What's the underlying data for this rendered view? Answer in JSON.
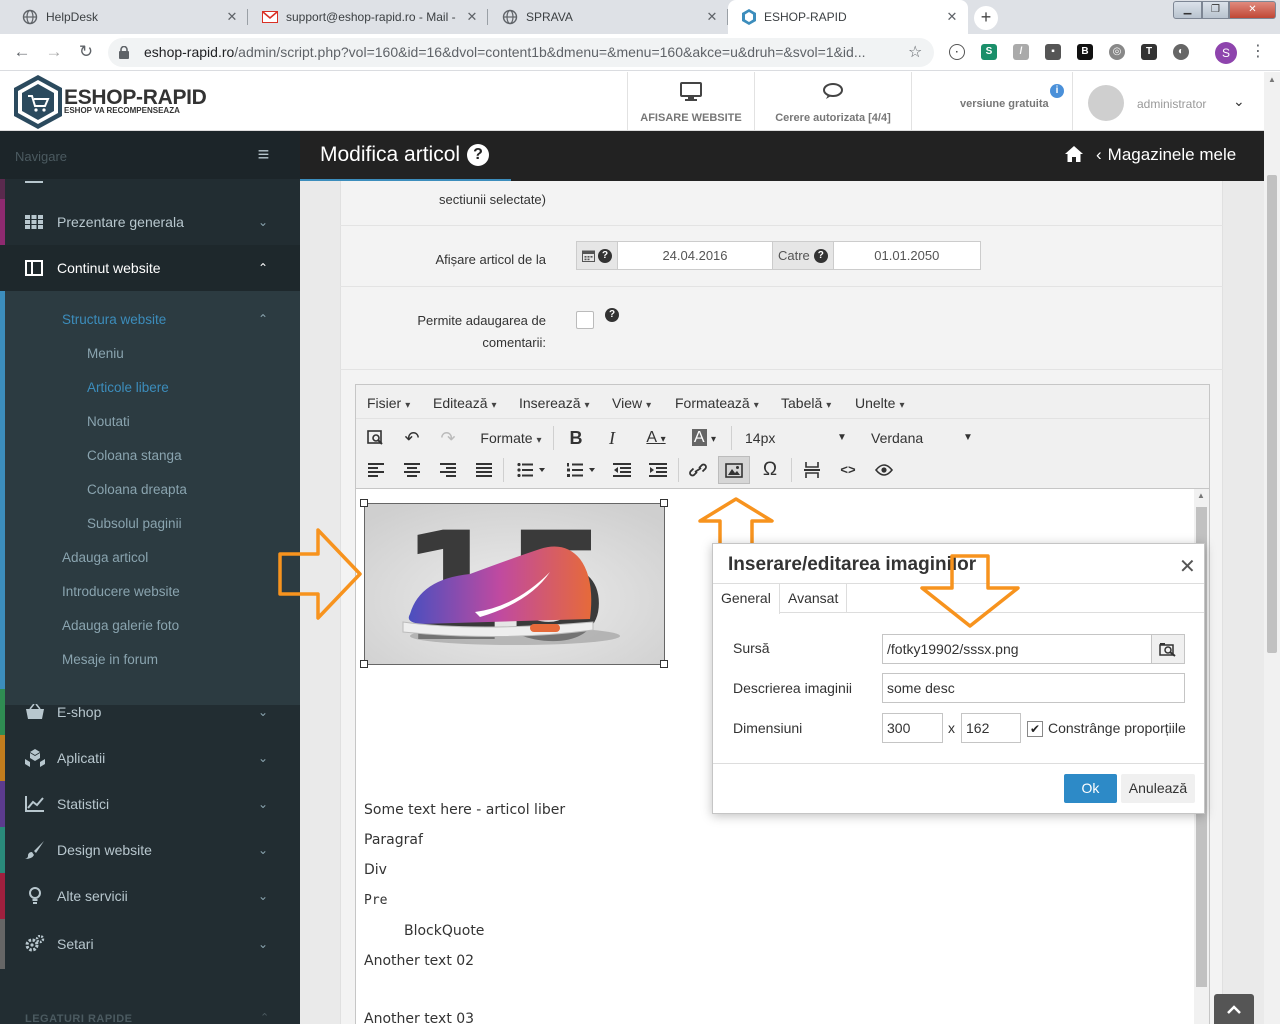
{
  "browser": {
    "tabs": [
      {
        "title": "HelpDesk",
        "icon": "globe-icon"
      },
      {
        "title": "support@eshop-rapid.ro - Mail -",
        "icon": "mail-icon"
      },
      {
        "title": "SPRAVA",
        "icon": "globe-icon"
      },
      {
        "title": "ESHOP-RAPID",
        "icon": "site-icon"
      }
    ],
    "close_glyph": "✕",
    "new_tab_glyph": "+",
    "url_host": "eshop-rapid.ro",
    "url_path": "/admin/script.php?vol=160&id=16&dvol=content1b&dmenu=&menu=160&akce=u&druh=&svol=1&id...",
    "profile_initial": "S"
  },
  "app": {
    "logo_name": "ESHOP-RAPID",
    "logo_tagline": "ESHOP VA RECOMPENSEAZA",
    "header_buttons": {
      "view_site": "AFISARE WEBSITE",
      "requests": "Cerere autorizata [4/4]"
    },
    "version_label": "versiune gratuita",
    "user_name": "administrator"
  },
  "sidebar": {
    "nav_label": "Navigare",
    "items": [
      {
        "label": "Prezentare generala",
        "icon": "grid-icon",
        "strip": "#8e2a70"
      },
      {
        "label": "Continut website",
        "icon": "columns-icon",
        "strip": "#3c8dbc"
      },
      {
        "label": "E-shop",
        "icon": "basket-icon",
        "strip": "#2f8c52"
      },
      {
        "label": "Aplicatii",
        "icon": "cubes-icon",
        "strip": "#c27d1e"
      },
      {
        "label": "Statistici",
        "icon": "chart-icon",
        "strip": "#5c3b8e"
      },
      {
        "label": "Design website",
        "icon": "brush-icon",
        "strip": "#2a8a7a"
      },
      {
        "label": "Alte servicii",
        "icon": "bulb-icon",
        "strip": "#a0203e"
      },
      {
        "label": "Setari",
        "icon": "cogs-icon",
        "strip": "#666666"
      }
    ],
    "sub_structura": "Structura website",
    "sub_items": [
      "Meniu",
      "Articole libere",
      "Noutati",
      "Coloana stanga",
      "Coloana dreapta",
      "Subsolul paginii"
    ],
    "sub_others": [
      "Adauga articol",
      "Introducere website",
      "Adauga galerie foto",
      "Mesaje in forum"
    ],
    "legaturi": "LEGATURI RAPIDE"
  },
  "page": {
    "title": "Modifica articol",
    "breadcrumb": "Magazinele mele",
    "fragment_label": "sectiunii selectate)",
    "afisare_label": "Afișare articol de la",
    "date_from": "24.04.2016",
    "catre_label": "Catre",
    "date_to": "01.01.2050",
    "comentarii_label_1": "Permite adaugarea de",
    "comentarii_label_2": "comentarii:"
  },
  "editor": {
    "menu": [
      "Fisier",
      "Editează",
      "Inserează",
      "View",
      "Formatează",
      "Tabelă",
      "Unelte"
    ],
    "formats_label": "Formate",
    "font_size": "14px",
    "font_family": "Verdana",
    "lines": [
      "Some text here - articol liber",
      "Paragraf",
      "Div",
      "Pre",
      "BlockQuote",
      "Another text 02",
      "Another text 03"
    ],
    "image_text": "15"
  },
  "dialog": {
    "title": "Inserare/editarea imaginilor",
    "tabs": [
      "General",
      "Avansat"
    ],
    "source_label": "Sursă",
    "source_value": "/fotky19902/sssx.png",
    "desc_label": "Descrierea imaginii",
    "desc_value": "some desc",
    "dims_label": "Dimensiuni",
    "width": "300",
    "x_sep": "x",
    "height": "162",
    "constrain_label": "Constrânge proporțiile",
    "constrain_checked": true,
    "ok": "Ok",
    "cancel": "Anulează"
  },
  "colors": {
    "accent": "#3c8dbc",
    "annotation": "#f7931e",
    "sidebar_bg": "#222d32"
  }
}
